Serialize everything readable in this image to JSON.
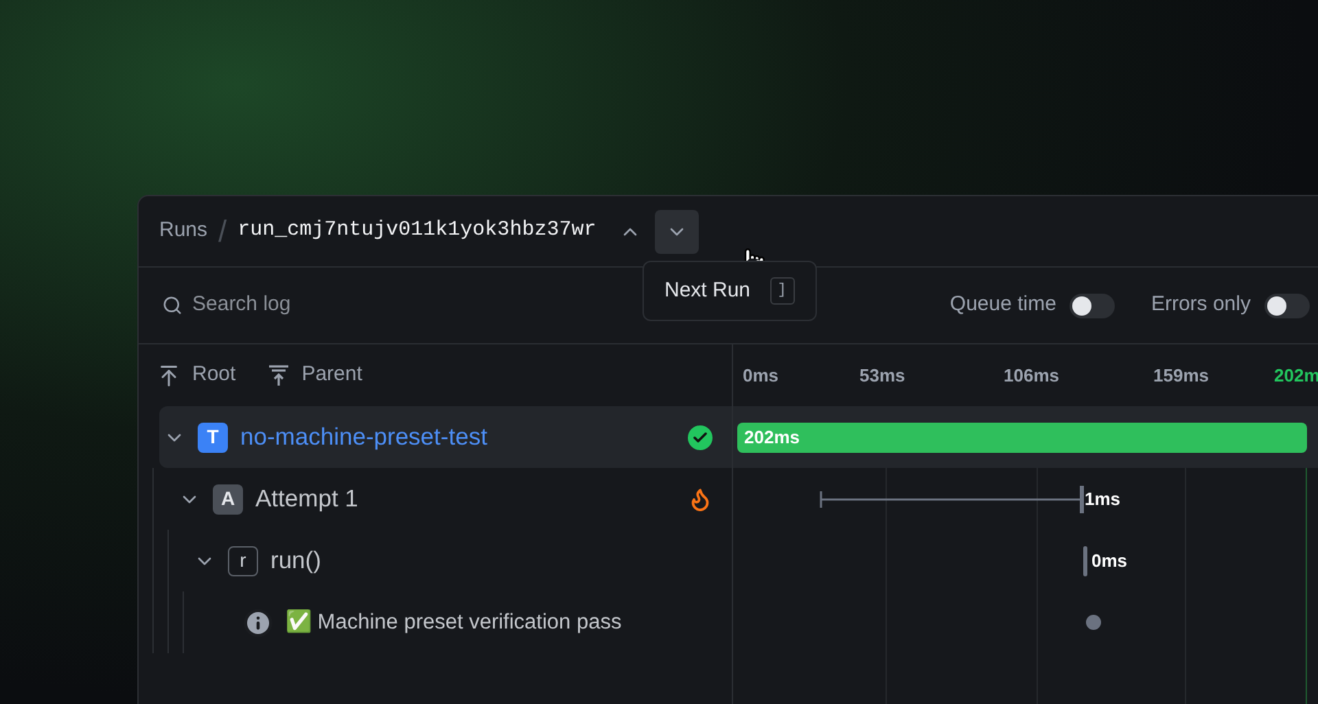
{
  "breadcrumb": {
    "section": "Runs",
    "separator": "/",
    "run_id": "run_cmj7ntujv011k1yok3hbz37wr"
  },
  "tooltip": {
    "label": "Next Run",
    "shortcut": "]"
  },
  "search": {
    "placeholder": "Search log"
  },
  "toggles": [
    {
      "label": "Queue time",
      "on": false
    },
    {
      "label": "Errors only",
      "on": false
    }
  ],
  "tree_nav": [
    {
      "label": "Root",
      "kind": "root"
    },
    {
      "label": "Parent",
      "kind": "parent"
    }
  ],
  "timeline_ticks": [
    {
      "label": "0ms",
      "current": false
    },
    {
      "label": "53ms",
      "current": false
    },
    {
      "label": "106ms",
      "current": false
    },
    {
      "label": "159ms",
      "current": false
    },
    {
      "label": "202m",
      "current": true
    }
  ],
  "tree": [
    {
      "kind": "task",
      "badge": "T",
      "name": "no-machine-preset-test",
      "completed": true,
      "selected": true,
      "expanded": true,
      "duration": "202ms",
      "children": [
        {
          "kind": "attempt",
          "badge": "A",
          "name": "Attempt 1",
          "completed": false,
          "selected": false,
          "expanded": true,
          "duration": "1ms",
          "children": [
            {
              "kind": "span",
              "badge": "r",
              "name": "run()",
              "selected": false,
              "expanded": true,
              "duration": "0ms",
              "children": [
                {
                  "kind": "log",
                  "name": "✅ Machine preset verification pass",
                  "selected": false
                }
              ]
            }
          ]
        }
      ]
    }
  ]
}
